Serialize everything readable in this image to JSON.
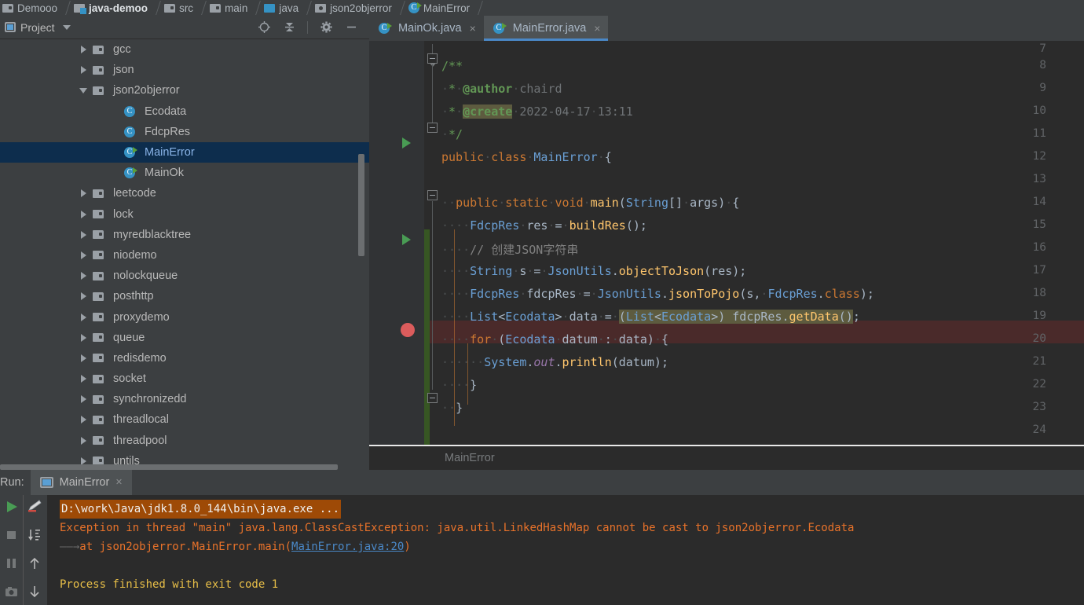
{
  "breadcrumb": [
    {
      "label": "Demooo",
      "icon": "folder-icon",
      "bold": false
    },
    {
      "label": "java-demoo",
      "icon": "module-folder-icon",
      "bold": true
    },
    {
      "label": "src",
      "icon": "folder-plain-icon",
      "bold": false
    },
    {
      "label": "main",
      "icon": "folder-plain-icon",
      "bold": false
    },
    {
      "label": "java",
      "icon": "source-root-icon",
      "bold": false
    },
    {
      "label": "json2objerror",
      "icon": "package-icon",
      "bold": false
    },
    {
      "label": "MainError",
      "icon": "class-runnable-icon",
      "bold": false
    }
  ],
  "project_panel": {
    "title": "Project",
    "window_icon": "project-window-icon",
    "dropdown_icon": "chevron-down-icon",
    "tools": [
      {
        "name": "locate-icon",
        "glyph": "⊕"
      },
      {
        "name": "collapse-all-icon",
        "glyph": "⤒"
      },
      {
        "name": "settings-gear-icon",
        "glyph": "⚙"
      },
      {
        "name": "hide-panel-icon",
        "glyph": "—"
      }
    ],
    "tree": [
      {
        "label": "gcc",
        "icon": "folder-icon",
        "arrow": "closed",
        "indent": 1,
        "selected": false
      },
      {
        "label": "json",
        "icon": "folder-icon",
        "arrow": "closed",
        "indent": 1,
        "selected": false
      },
      {
        "label": "json2objerror",
        "icon": "folder-icon",
        "arrow": "open",
        "indent": 1,
        "selected": false
      },
      {
        "label": "Ecodata",
        "icon": "class-icon",
        "arrow": "none",
        "indent": 2,
        "selected": false
      },
      {
        "label": "FdcpRes",
        "icon": "class-icon",
        "arrow": "none",
        "indent": 2,
        "selected": false
      },
      {
        "label": "MainError",
        "icon": "class-runnable-icon",
        "arrow": "none",
        "indent": 2,
        "selected": true
      },
      {
        "label": "MainOk",
        "icon": "class-runnable-icon",
        "arrow": "none",
        "indent": 2,
        "selected": false
      },
      {
        "label": "leetcode",
        "icon": "folder-icon",
        "arrow": "closed",
        "indent": 1,
        "selected": false
      },
      {
        "label": "lock",
        "icon": "folder-icon",
        "arrow": "closed",
        "indent": 1,
        "selected": false
      },
      {
        "label": "myredblacktree",
        "icon": "folder-icon",
        "arrow": "closed",
        "indent": 1,
        "selected": false
      },
      {
        "label": "niodemo",
        "icon": "folder-icon",
        "arrow": "closed",
        "indent": 1,
        "selected": false
      },
      {
        "label": "nolockqueue",
        "icon": "folder-icon",
        "arrow": "closed",
        "indent": 1,
        "selected": false
      },
      {
        "label": "posthttp",
        "icon": "folder-icon",
        "arrow": "closed",
        "indent": 1,
        "selected": false
      },
      {
        "label": "proxydemo",
        "icon": "folder-icon",
        "arrow": "closed",
        "indent": 1,
        "selected": false
      },
      {
        "label": "queue",
        "icon": "folder-icon",
        "arrow": "closed",
        "indent": 1,
        "selected": false
      },
      {
        "label": "redisdemo",
        "icon": "folder-icon",
        "arrow": "closed",
        "indent": 1,
        "selected": false
      },
      {
        "label": "socket",
        "icon": "folder-icon",
        "arrow": "closed",
        "indent": 1,
        "selected": false
      },
      {
        "label": "synchronizedd",
        "icon": "folder-icon",
        "arrow": "closed",
        "indent": 1,
        "selected": false
      },
      {
        "label": "threadlocal",
        "icon": "folder-icon",
        "arrow": "closed",
        "indent": 1,
        "selected": false
      },
      {
        "label": "threadpool",
        "icon": "folder-icon",
        "arrow": "closed",
        "indent": 1,
        "selected": false
      },
      {
        "label": "untils",
        "icon": "folder-icon",
        "arrow": "closed",
        "indent": 1,
        "selected": false
      }
    ]
  },
  "editor": {
    "tabs": [
      {
        "label": "MainOk.java",
        "icon": "class-runnable-icon",
        "close": "×",
        "active": false
      },
      {
        "label": "MainError.java",
        "icon": "class-runnable-icon",
        "close": "×",
        "active": true
      }
    ],
    "first_partial_line_number": "7",
    "line_numbers": [
      "8",
      "9",
      "10",
      "11",
      "12",
      "13",
      "14",
      "15",
      "16",
      "17",
      "18",
      "19",
      "20",
      "21",
      "22",
      "23",
      "24"
    ],
    "lines": {
      "l8": "/**",
      "l9_star": "*",
      "l9_tag": "@author",
      "l9_val": "chaird",
      "l10_star": "*",
      "l10_tag": "@create",
      "l10_val": "2022-04-17 13:11",
      "l11": "*/",
      "l12_kw1": "public",
      "l12_kw2": "class",
      "l12_name": "MainError",
      "l12_brace": "{",
      "l14": "public static void main(String[] args) {",
      "l15": "FdcpRes res = buildRes();",
      "l16": "// 创建JSON字符串",
      "l17": "String s = JsonUtils.objectToJson(res);",
      "l18": "FdcpRes fdcpRes = JsonUtils.jsonToPojo(s, FdcpRes.class);",
      "l19_a": "List<Ecodata> data = ",
      "l19_hl": "(List<Ecodata>) fdcpRes.getData()",
      "l19_b": ";",
      "l20": "for (Ecodata datum : data) {",
      "l21": "System.out.println(datum);",
      "l22": "}",
      "l23": "}"
    },
    "breadcrumb_status": "MainError"
  },
  "run_panel": {
    "label": "Run:",
    "tab": {
      "label": "MainError",
      "icon": "run-config-icon",
      "close": "×"
    },
    "side_icons_col1": [
      {
        "name": "rerun-play-icon"
      },
      {
        "name": "stop-icon"
      },
      {
        "name": "pause-icon"
      },
      {
        "name": "camera-snapshot-icon"
      }
    ],
    "side_icons_col2": [
      {
        "name": "soft-wrap-pencil-icon"
      },
      {
        "name": "scroll-to-end-icon"
      },
      {
        "name": "up-arrow-icon"
      },
      {
        "name": "down-arrow-icon"
      }
    ],
    "console": {
      "command": "D:\\work\\Java\\jdk1.8.0_144\\bin\\java.exe ...",
      "exception": "Exception in thread \"main\" java.lang.ClassCastException: java.util.LinkedHashMap cannot be cast to json2objerror.Ecodata",
      "stack_prefix": "at json2objerror.MainError.main(",
      "stack_link": "MainError.java:20",
      "stack_suffix": ")",
      "result": "Process finished with exit code 1"
    }
  },
  "colors": {
    "panel_bg": "#3c3f41",
    "editor_bg": "#2b2b2b",
    "selection": "#0d2d4d",
    "accent": "#4a88c7",
    "error_line": "#4a2a2a",
    "console_error": "#e8722a",
    "console_ok": "#e8bf48",
    "command_bg": "#9e4a06"
  }
}
